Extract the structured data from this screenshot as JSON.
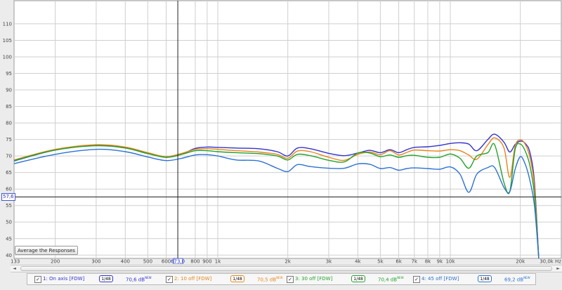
{
  "chart_data": {
    "type": "line",
    "title": "",
    "xlabel": "",
    "ylabel": "",
    "x_scale": "log",
    "xlim": [
      133,
      30000
    ],
    "ylim": [
      39,
      117
    ],
    "y_ticks": [
      40,
      45,
      50,
      55,
      60,
      65,
      70,
      75,
      80,
      85,
      90,
      95,
      100,
      105,
      110
    ],
    "y_tick_labels": [
      "40",
      "45",
      "50",
      "55",
      "60",
      "65",
      "70",
      "75",
      "80",
      "85",
      "90",
      "95",
      "100",
      "105",
      "110"
    ],
    "x_ticks": [
      133,
      200,
      300,
      400,
      500,
      600,
      673,
      800,
      900,
      1000,
      2000,
      3000,
      4000,
      5000,
      6000,
      7000,
      8000,
      9000,
      10000,
      20000,
      30000
    ],
    "x_tick_labels": [
      "133",
      "200",
      "300",
      "400",
      "500",
      "600",
      "673,0",
      "800",
      "900",
      "1k",
      "2k",
      "3k",
      "4k",
      "5k",
      "6k",
      "7k",
      "8k",
      "9k",
      "10k",
      "20k",
      "30,0k Hz"
    ],
    "cursor": {
      "x": 673,
      "y": 57.6
    },
    "series": [
      {
        "name": "1: On axis [FDW]",
        "color": "#3333cc",
        "points": [
          [
            133,
            68.5
          ],
          [
            200,
            71.8
          ],
          [
            300,
            73.2
          ],
          [
            400,
            72.6
          ],
          [
            500,
            70.9
          ],
          [
            600,
            69.6
          ],
          [
            700,
            70.6
          ],
          [
            800,
            72.3
          ],
          [
            900,
            72.7
          ],
          [
            1000,
            72.6
          ],
          [
            1200,
            72.4
          ],
          [
            1500,
            72.2
          ],
          [
            1800,
            71.3
          ],
          [
            2000,
            70.0
          ],
          [
            2200,
            72.4
          ],
          [
            2500,
            72.2
          ],
          [
            3000,
            70.8
          ],
          [
            3500,
            70.1
          ],
          [
            4000,
            70.9
          ],
          [
            4500,
            71.7
          ],
          [
            5000,
            71.0
          ],
          [
            5500,
            71.9
          ],
          [
            6000,
            71.0
          ],
          [
            6500,
            71.9
          ],
          [
            7000,
            72.6
          ],
          [
            8000,
            72.8
          ],
          [
            9000,
            73.2
          ],
          [
            10000,
            73.8
          ],
          [
            11000,
            74.0
          ],
          [
            12000,
            73.6
          ],
          [
            13000,
            71.6
          ],
          [
            14500,
            75.0
          ],
          [
            15500,
            76.6
          ],
          [
            17000,
            74.2
          ],
          [
            18000,
            71.2
          ],
          [
            19000,
            73.5
          ],
          [
            20000,
            74.5
          ],
          [
            21000,
            73.8
          ],
          [
            22000,
            71.0
          ],
          [
            23000,
            62.0
          ],
          [
            24000,
            39.0
          ]
        ]
      },
      {
        "name": "2: 10 off [FDW]",
        "color": "#e8841a",
        "points": [
          [
            133,
            68.8
          ],
          [
            200,
            72.0
          ],
          [
            300,
            73.4
          ],
          [
            400,
            72.7
          ],
          [
            500,
            71.0
          ],
          [
            600,
            69.8
          ],
          [
            700,
            70.8
          ],
          [
            800,
            72.0
          ],
          [
            900,
            72.2
          ],
          [
            1000,
            72.0
          ],
          [
            1200,
            71.6
          ],
          [
            1500,
            71.2
          ],
          [
            1800,
            70.5
          ],
          [
            2000,
            69.3
          ],
          [
            2200,
            71.5
          ],
          [
            2500,
            71.3
          ],
          [
            3000,
            69.6
          ],
          [
            3500,
            68.7
          ],
          [
            4000,
            70.5
          ],
          [
            4500,
            71.2
          ],
          [
            5000,
            70.4
          ],
          [
            5500,
            71.6
          ],
          [
            6000,
            70.3
          ],
          [
            6500,
            71.1
          ],
          [
            7000,
            71.8
          ],
          [
            8000,
            71.6
          ],
          [
            9000,
            71.5
          ],
          [
            10000,
            71.9
          ],
          [
            11000,
            71.6
          ],
          [
            12000,
            70.3
          ],
          [
            13000,
            69.0
          ],
          [
            14500,
            73.4
          ],
          [
            15500,
            75.5
          ],
          [
            17000,
            72.5
          ],
          [
            18000,
            63.5
          ],
          [
            19000,
            73.0
          ],
          [
            20000,
            74.9
          ],
          [
            21000,
            73.5
          ],
          [
            22000,
            69.5
          ],
          [
            23000,
            60.5
          ],
          [
            24000,
            39.0
          ]
        ]
      },
      {
        "name": "3: 30 off [FDW]",
        "color": "#22a22a",
        "points": [
          [
            133,
            68.6
          ],
          [
            200,
            71.8
          ],
          [
            300,
            73.1
          ],
          [
            400,
            72.4
          ],
          [
            500,
            70.7
          ],
          [
            600,
            69.6
          ],
          [
            700,
            70.5
          ],
          [
            800,
            71.6
          ],
          [
            900,
            71.6
          ],
          [
            1000,
            71.3
          ],
          [
            1200,
            71.0
          ],
          [
            1500,
            70.7
          ],
          [
            1800,
            70.0
          ],
          [
            2000,
            68.8
          ],
          [
            2200,
            70.5
          ],
          [
            2500,
            70.1
          ],
          [
            3000,
            68.7
          ],
          [
            3500,
            68.2
          ],
          [
            4000,
            70.9
          ],
          [
            4500,
            70.9
          ],
          [
            5000,
            69.8
          ],
          [
            5500,
            70.3
          ],
          [
            6000,
            69.6
          ],
          [
            6500,
            70.1
          ],
          [
            7000,
            70.2
          ],
          [
            8000,
            69.6
          ],
          [
            9000,
            69.6
          ],
          [
            10000,
            70.6
          ],
          [
            11000,
            69.3
          ],
          [
            12000,
            66.3
          ],
          [
            13000,
            70.0
          ],
          [
            14500,
            71.0
          ],
          [
            15500,
            73.4
          ],
          [
            17000,
            62.0
          ],
          [
            18000,
            59.2
          ],
          [
            19000,
            72.0
          ],
          [
            20000,
            73.6
          ],
          [
            21000,
            71.5
          ],
          [
            22000,
            67.0
          ],
          [
            23000,
            58.0
          ],
          [
            24000,
            39.0
          ]
        ]
      },
      {
        "name": "4: 45 off [FDW]",
        "color": "#2c72d2",
        "points": [
          [
            133,
            67.7
          ],
          [
            200,
            70.5
          ],
          [
            300,
            72.0
          ],
          [
            400,
            71.3
          ],
          [
            500,
            69.7
          ],
          [
            600,
            68.6
          ],
          [
            700,
            69.3
          ],
          [
            800,
            70.3
          ],
          [
            900,
            70.4
          ],
          [
            1000,
            70.0
          ],
          [
            1200,
            68.8
          ],
          [
            1500,
            68.5
          ],
          [
            1800,
            66.3
          ],
          [
            2000,
            65.3
          ],
          [
            2200,
            67.4
          ],
          [
            2500,
            66.8
          ],
          [
            3000,
            66.3
          ],
          [
            3500,
            66.3
          ],
          [
            4000,
            67.6
          ],
          [
            4500,
            67.5
          ],
          [
            5000,
            66.2
          ],
          [
            5500,
            66.5
          ],
          [
            6000,
            65.7
          ],
          [
            6500,
            66.2
          ],
          [
            7000,
            66.4
          ],
          [
            8000,
            66.2
          ],
          [
            9000,
            66.0
          ],
          [
            10000,
            66.7
          ],
          [
            11000,
            64.5
          ],
          [
            12000,
            59.0
          ],
          [
            13000,
            64.5
          ],
          [
            14500,
            66.5
          ],
          [
            15500,
            66.5
          ],
          [
            17000,
            60.5
          ],
          [
            18000,
            59.2
          ],
          [
            19000,
            66.0
          ],
          [
            20000,
            69.8
          ],
          [
            21000,
            67.5
          ],
          [
            22000,
            62.5
          ],
          [
            23000,
            55.0
          ],
          [
            24000,
            39.0
          ]
        ]
      }
    ]
  },
  "button": {
    "average": "Average the Responses"
  },
  "cursor_x_label": "673,0",
  "cursor_y_label": "57,6",
  "legend": [
    {
      "checked": "✓",
      "name": "1: On axis [FDW]",
      "color": "#3333cc",
      "smoothing": "1/48",
      "level": "70,6 dB",
      "tag": "NEW"
    },
    {
      "checked": "✓",
      "name": "2: 10 off [FDW]",
      "color": "#e8841a",
      "smoothing": "1/48",
      "level": "70,5 dB",
      "tag": "NEW"
    },
    {
      "checked": "✓",
      "name": "3: 30 off [FDW]",
      "color": "#22a22a",
      "smoothing": "1/48",
      "level": "70,4 dB",
      "tag": "NEW"
    },
    {
      "checked": "✓",
      "name": "4: 45 off [FDW]",
      "color": "#2c72d2",
      "smoothing": "1/48",
      "level": "69,2 dB",
      "tag": "NEW"
    }
  ],
  "scroll": {
    "left": "◄",
    "right": "►"
  }
}
